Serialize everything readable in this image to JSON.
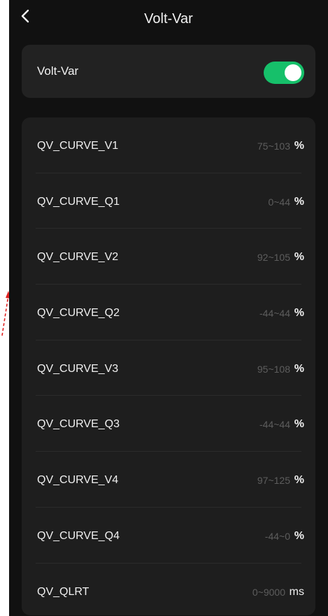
{
  "header": {
    "title": "Volt-Var",
    "back_icon": "chevron-left-icon"
  },
  "toggle": {
    "label": "Volt-Var",
    "state": "on",
    "color": "#16c06a"
  },
  "params": [
    {
      "name": "QV_CURVE_V1",
      "range": "75~103",
      "unit": "%"
    },
    {
      "name": "QV_CURVE_Q1",
      "range": "0~44",
      "unit": "%"
    },
    {
      "name": "QV_CURVE_V2",
      "range": "92~105",
      "unit": "%"
    },
    {
      "name": "QV_CURVE_Q2",
      "range": "-44~44",
      "unit": "%"
    },
    {
      "name": "QV_CURVE_V3",
      "range": "95~108",
      "unit": "%"
    },
    {
      "name": "QV_CURVE_Q3",
      "range": "-44~44",
      "unit": "%"
    },
    {
      "name": "QV_CURVE_V4",
      "range": "97~125",
      "unit": "%"
    },
    {
      "name": "QV_CURVE_Q4",
      "range": "-44~0",
      "unit": "%"
    },
    {
      "name": "QV_QLRT",
      "range": "0~9000",
      "unit": "ms"
    }
  ],
  "colors": {
    "background": "#111111",
    "card": "#1e1e1e",
    "annotation_arrow": "#e02020"
  }
}
